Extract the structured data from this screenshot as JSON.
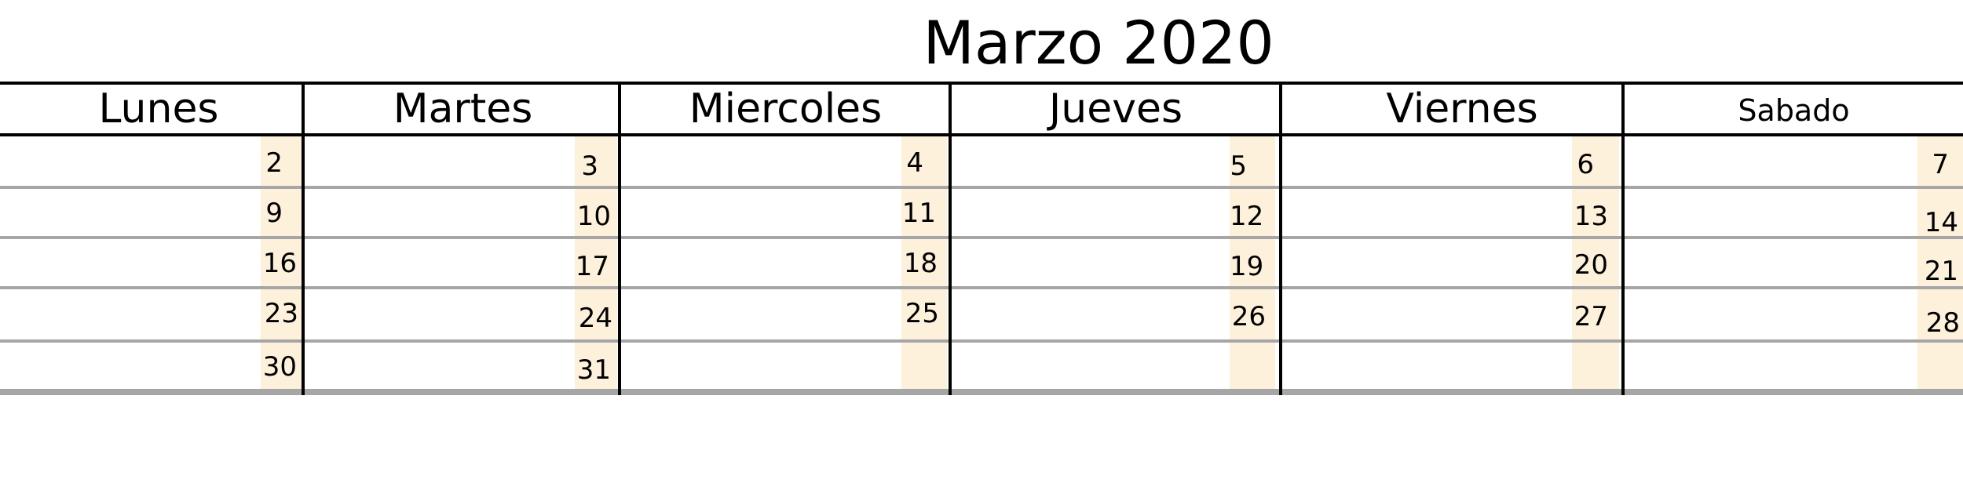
{
  "calendar": {
    "title": "Marzo 2020",
    "weekdays": [
      "Lunes",
      "Martes",
      "Miercoles",
      "Jueves",
      "Viernes",
      "Sabado"
    ],
    "rows": [
      [
        "2",
        "3",
        "4",
        "5",
        "6",
        "7"
      ],
      [
        "9",
        "10",
        "11",
        "12",
        "13",
        "14"
      ],
      [
        "16",
        "17",
        "18",
        "19",
        "20",
        "21"
      ],
      [
        "23",
        "24",
        "25",
        "26",
        "27",
        "28"
      ],
      [
        "30",
        "31",
        "",
        "",
        "",
        ""
      ]
    ],
    "colors": {
      "shade": "#fdf1dc",
      "grid_dark": "#000000",
      "grid_light": "#a6a6a6"
    }
  }
}
